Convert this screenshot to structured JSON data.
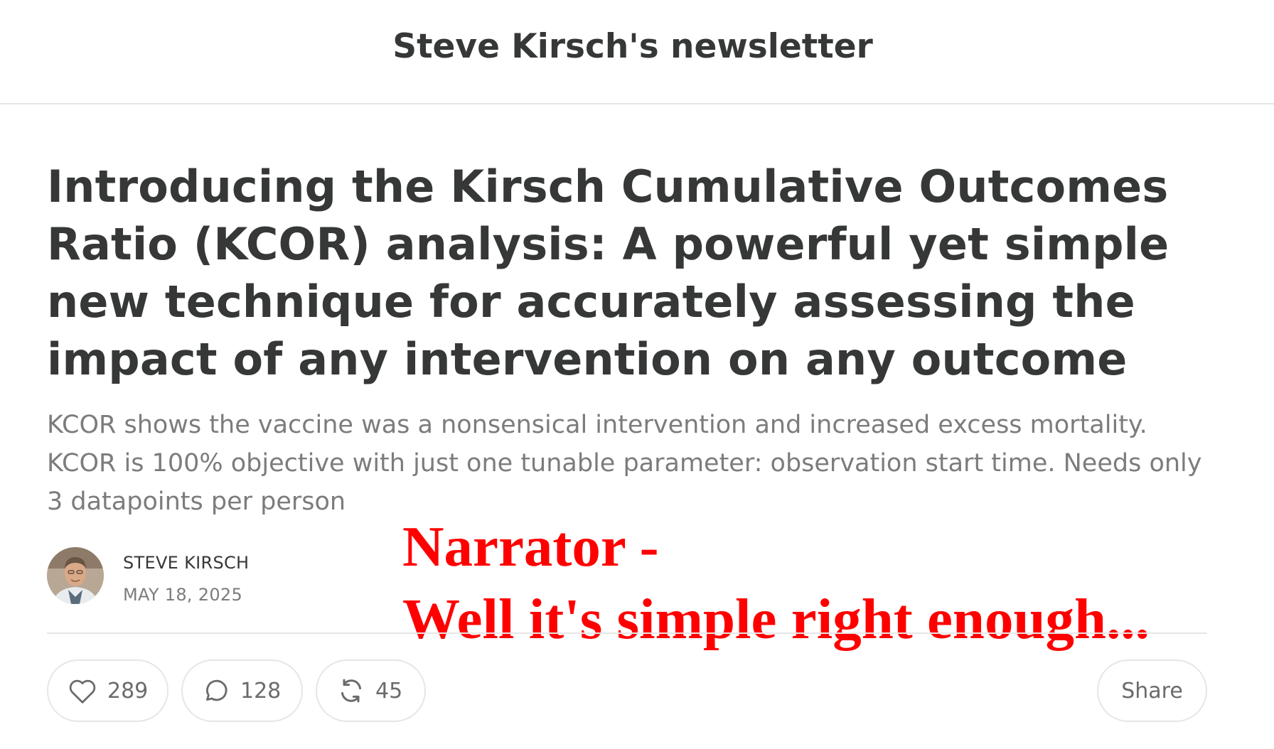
{
  "header": {
    "publication_name": "Steve Kirsch's newsletter"
  },
  "post": {
    "title": "Introducing the Kirsch Cumulative Outcomes Ratio (KCOR) analysis: A powerful yet simple new technique for accurately assessing the impact of any intervention on any outcome",
    "subtitle": "KCOR shows the vaccine was a nonsensical intervention and increased excess mortality. KCOR is 100% objective with just one tunable parameter: observation start time. Needs only 3 datapoints per person",
    "author": "STEVE KIRSCH",
    "date": "MAY 18, 2025"
  },
  "overlay": {
    "line1": "Narrator -",
    "line2": "Well it's simple right enough...",
    "color": "#ff0000"
  },
  "actions": {
    "likes": "289",
    "comments": "128",
    "restacks": "45",
    "share_label": "Share"
  },
  "icons": {
    "like": "heart-icon",
    "comment": "comment-bubble-icon",
    "restack": "restack-icon"
  }
}
